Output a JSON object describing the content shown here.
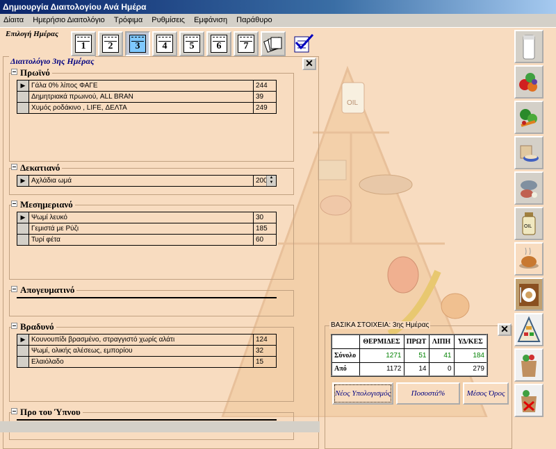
{
  "window": {
    "title": "Δημιουργία Διαιτολογίου Ανά Ημέρα"
  },
  "menu": [
    "Δίαιτα",
    "Ημερήσιο Διαιτολόγιο",
    "Τρόφιμα",
    "Ρυθμίσεις",
    "Εμφάνιση",
    "Παράθυρο"
  ],
  "day_select": {
    "label": "Επιλογή Ημέρας",
    "days": [
      "1",
      "2",
      "3",
      "4",
      "5",
      "6",
      "7"
    ],
    "active": "3"
  },
  "diet": {
    "title": "Διαιτολόγιο 3ης Ημέρας",
    "sections": [
      {
        "name": "Πρωϊνό",
        "items": [
          {
            "food": "Γάλα 0% λίπος ΦΑΓΕ",
            "qty": "244"
          },
          {
            "food": "Δημητριακά πρωινού, ALL BRAN",
            "qty": "39"
          },
          {
            "food": "Χυμός ροδάκινο , LIFE, ΔΕΛΤΑ",
            "qty": "249"
          }
        ]
      },
      {
        "name": "Δεκατιανό",
        "items": [
          {
            "food": "Αχλάδια ωμά",
            "qty": "200"
          }
        ]
      },
      {
        "name": "Μεσημεριανό",
        "items": [
          {
            "food": "Ψωμί λευκό",
            "qty": "30"
          },
          {
            "food": "Γεμιστά με Ρύζι",
            "qty": "185"
          },
          {
            "food": "Τυρί φέτα",
            "qty": "60"
          }
        ]
      },
      {
        "name": "Απογευματινό",
        "items": []
      },
      {
        "name": "Βραδυνό",
        "items": [
          {
            "food": "Κουνουπίδι βρασμένο, στραγγιστό χωρίς αλάτι",
            "qty": "124"
          },
          {
            "food": "Ψωμί, ολικής αλέσεως, εμπορίου",
            "qty": "32"
          },
          {
            "food": "Ελαιόλαδο",
            "qty": "15"
          }
        ]
      },
      {
        "name": "Προ του Ύπνου",
        "items": []
      }
    ]
  },
  "stats": {
    "title": "ΒΑΣΙΚΑ ΣΤΟΙΧΕΙΑ: 3ης Ημέρας",
    "headers": [
      "ΘΕΡΜΙΔΕΣ",
      "ΠΡΩΤ",
      "ΛΙΠΗ",
      "ΥΔ/ΚΕΣ"
    ],
    "rows": [
      {
        "label": "Σύνολο",
        "values": [
          "1271",
          "51",
          "41",
          "184"
        ]
      },
      {
        "label": "Από",
        "values": [
          "1172",
          "14",
          "0",
          "279"
        ]
      }
    ],
    "buttons": [
      "Νέος Υπολογισμός",
      "Ποσοστά%",
      "Μέσος Όρος"
    ]
  },
  "toolbar_icons": [
    "milk-icon",
    "fruits-icon",
    "vegetables-icon",
    "cereals-icon",
    "meat-fish-icon",
    "oil-icon",
    "cooked-food-icon",
    "meal-plate-icon",
    "food-pyramid-icon",
    "groceries-bag-icon",
    "groceries-remove-icon"
  ],
  "colors": {
    "background": "#f8dcc0",
    "title_blue": "#0a246a",
    "accent_green": "#008000",
    "label_navy": "#000080"
  }
}
